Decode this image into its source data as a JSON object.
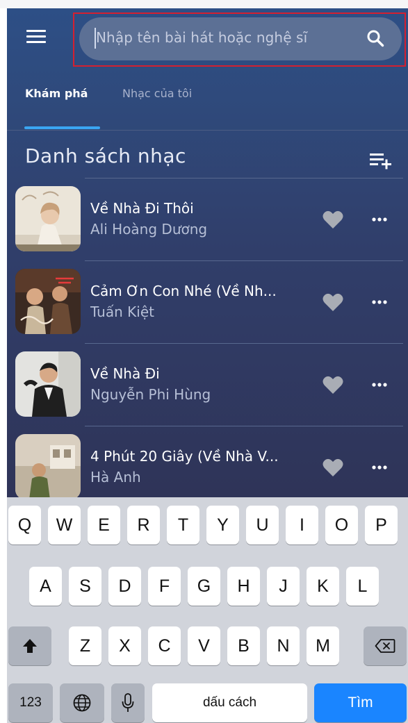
{
  "search": {
    "placeholder": "Nhập tên bài hát hoặc nghệ sĩ"
  },
  "tabs": [
    {
      "label": "Khám phá",
      "active": true
    },
    {
      "label": "Nhạc của tôi",
      "active": false
    }
  ],
  "section": {
    "title": "Danh sách nhạc"
  },
  "songs": [
    {
      "title": "Về Nhà Đi Thôi",
      "artist": "Ali Hoàng Dương"
    },
    {
      "title": "Cảm Ơn Con Nhé (Về Nh...",
      "artist": "Tuấn Kiệt"
    },
    {
      "title": "Về Nhà Đi",
      "artist": "Nguyễn Phi Hùng"
    },
    {
      "title": "4 Phút 20 Giây (Về Nhà V...",
      "artist": "Hà Anh"
    }
  ],
  "keyboard": {
    "row1": [
      "Q",
      "W",
      "E",
      "R",
      "T",
      "Y",
      "U",
      "I",
      "O",
      "P"
    ],
    "row2": [
      "A",
      "S",
      "D",
      "F",
      "G",
      "H",
      "J",
      "K",
      "L"
    ],
    "row3": [
      "Z",
      "X",
      "C",
      "V",
      "B",
      "N",
      "M"
    ],
    "numbers_label": "123",
    "space_label": "dấu cách",
    "go_label": "Tìm"
  },
  "colors": {
    "accent": "#3aa6f2",
    "highlight_frame": "#d42030",
    "app_background": "#303e6a",
    "go_key": "#1a85ff"
  }
}
